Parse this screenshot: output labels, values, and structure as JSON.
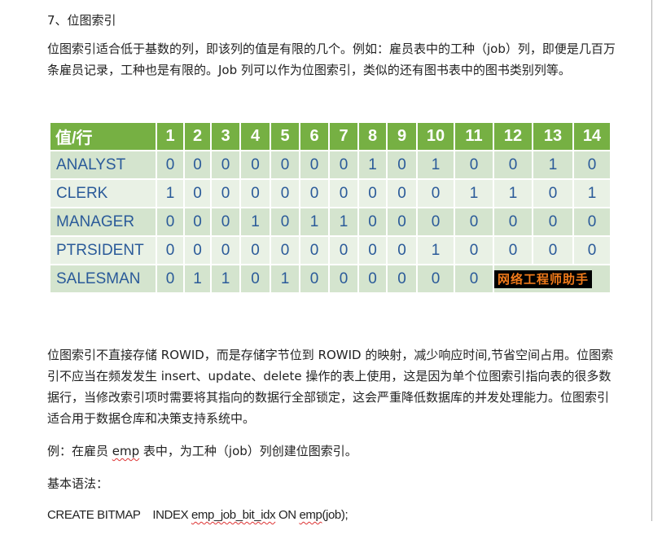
{
  "heading": "7、位图索引",
  "intro": "位图索引适合低于基数的列，即该列的值是有限的几个。例如：雇员表中的工种（job）列，即便是几百万条雇员记录，工种也是有限的。Job 列可以作为位图索引，类似的还有图书表中的图书类别列等。",
  "table": {
    "corner": "值/行",
    "columns": [
      "1",
      "2",
      "3",
      "4",
      "5",
      "6",
      "7",
      "8",
      "9",
      "10",
      "11",
      "12",
      "13",
      "14"
    ],
    "rows": [
      {
        "name": "ANALYST",
        "values": [
          "0",
          "0",
          "0",
          "0",
          "0",
          "0",
          "0",
          "1",
          "0",
          "1",
          "0",
          "0",
          "1",
          "0"
        ]
      },
      {
        "name": "CLERK",
        "values": [
          "1",
          "0",
          "0",
          "0",
          "0",
          "0",
          "0",
          "0",
          "0",
          "0",
          "1",
          "1",
          "0",
          "1"
        ]
      },
      {
        "name": "MANAGER",
        "values": [
          "0",
          "0",
          "0",
          "1",
          "0",
          "1",
          "1",
          "0",
          "0",
          "0",
          "0",
          "0",
          "0",
          "0"
        ]
      },
      {
        "name": "PTRSIDENT",
        "values": [
          "0",
          "0",
          "0",
          "0",
          "0",
          "0",
          "0",
          "0",
          "0",
          "1",
          "0",
          "0",
          "0",
          "0"
        ]
      },
      {
        "name": "SALESMAN",
        "values": [
          "0",
          "1",
          "1",
          "0",
          "1",
          "0",
          "0",
          "0",
          "0",
          "0",
          "0"
        ]
      }
    ],
    "watermark": "网络工程师助手"
  },
  "desc": "位图索引不直接存储 ROWID，而是存储字节位到 ROWID 的映射，减少响应时间,节省空间占用。位图索引不应当在频发发生 insert、update、delete 操作的表上使用，这是因为单个位图索引指向表的很多数据行，当修改索引项时需要将其指向的数据行全部锁定，这会严重降低数据库的并发处理能力。位图索引适合用于数据仓库和决策支持系统中。",
  "example": {
    "pre": "例：在雇员 ",
    "emp": "emp",
    "post": " 表中，为工种（job）列创建位图索引。"
  },
  "syntax_label": "基本语法：",
  "code": {
    "a": "CREATE BITMAP    INDEX ",
    "idx": "emp_job_bit_idx",
    "b": " ON ",
    "emp": "emp",
    "c": "(job);"
  }
}
